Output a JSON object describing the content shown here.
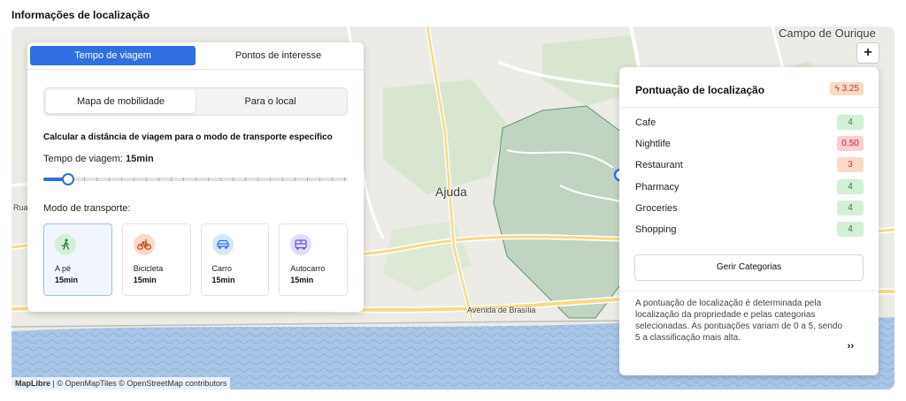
{
  "section_title": "Informações de localização",
  "map": {
    "labels": {
      "campo_de_ourique": "Campo de Ourique",
      "ajuda": "Ajuda",
      "avenida": "Avenida de Brasília",
      "rua": "Rua"
    },
    "zoom_in": "+",
    "attribution_brand": "MapLibre",
    "attribution_rest": " | © OpenMapTiles © OpenStreetMap contributors"
  },
  "left_panel": {
    "tabs": [
      "Tempo de viagem",
      "Pontos de interesse"
    ],
    "segments": [
      "Mapa de mobilidade",
      "Para o local"
    ],
    "calc_title": "Calcular a distância de viagem para o modo de transporte específico",
    "travel_time_label": "Tempo de viagem:",
    "travel_time_value": "15min",
    "slider_fraction": 0.08,
    "mode_label": "Modo de transporte:",
    "modes": [
      {
        "name": "A pé",
        "time": "15min",
        "icon": "walk-icon",
        "color": "#d3efd8",
        "fg": "#2a7a3c"
      },
      {
        "name": "Bicicleta",
        "time": "15min",
        "icon": "bike-icon",
        "color": "#fbd9c7",
        "fg": "#c0451b"
      },
      {
        "name": "Carro",
        "time": "15min",
        "icon": "car-icon",
        "color": "#d6e6fb",
        "fg": "#2f6fdf"
      },
      {
        "name": "Autocarro",
        "time": "15min",
        "icon": "bus-icon",
        "color": "#e2dbf7",
        "fg": "#6a4fc7"
      }
    ]
  },
  "right_panel": {
    "title": "Pontuação de localização",
    "score": "3.25",
    "categories": [
      {
        "name": "Cafe",
        "value": "4",
        "tone": "green"
      },
      {
        "name": "Nightlife",
        "value": "0.50",
        "tone": "red"
      },
      {
        "name": "Restaurant",
        "value": "3",
        "tone": "orange"
      },
      {
        "name": "Pharmacy",
        "value": "4",
        "tone": "green"
      },
      {
        "name": "Groceries",
        "value": "4",
        "tone": "green"
      },
      {
        "name": "Shopping",
        "value": "4",
        "tone": "green"
      }
    ],
    "manage_label": "Gerir Categorias",
    "description": "A pontuação de localização é determinada pela localização da propriedade e pelas categorias selecionadas. As pontuações variam de 0 a 5, sendo 5 a classificação mais alta.",
    "expand_label": "››"
  },
  "colors": {
    "accent": "#2f6fdf",
    "water": "#aac6e6",
    "park": "#cfe3c6",
    "isochrone": "#5c9a6e"
  }
}
